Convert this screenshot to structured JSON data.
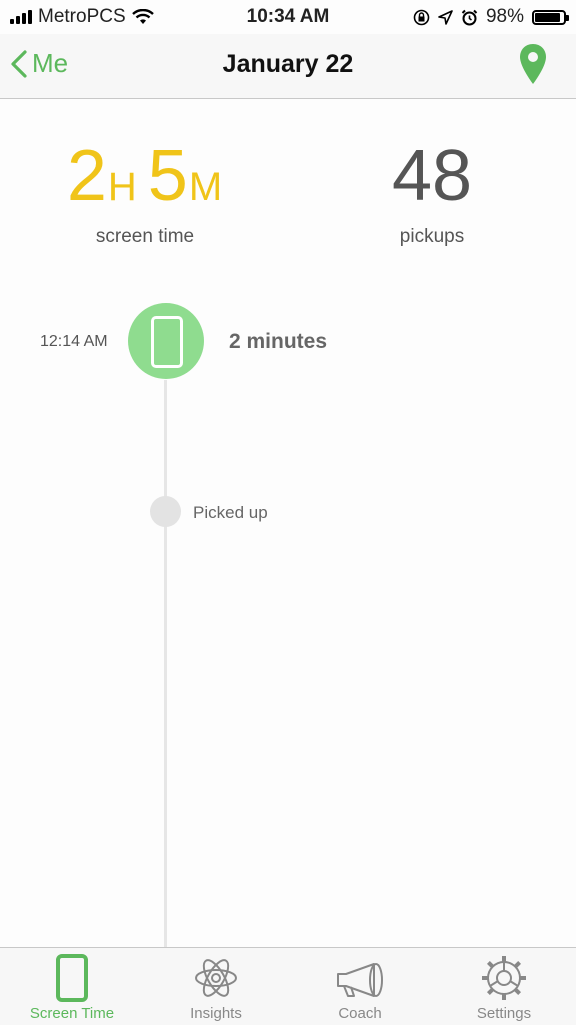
{
  "status": {
    "carrier": "MetroPCS",
    "time": "10:34 AM",
    "battery": "98%",
    "battery_level": 0.98
  },
  "nav": {
    "back_label": "Me",
    "title": "January 22",
    "location_icon": "location-pin-icon"
  },
  "stats": {
    "screen_time_hours": "2",
    "screen_time_hours_unit": "H",
    "screen_time_minutes": "5",
    "screen_time_minutes_unit": "M",
    "screen_time_label": "screen time",
    "pickups_value": "48",
    "pickups_label": "pickups"
  },
  "timeline": {
    "session_time": "12:14 AM",
    "session_duration": "2 minutes",
    "event_label": "Picked up"
  },
  "tabs": [
    {
      "label": "Screen Time",
      "icon": "phone-icon",
      "active": true
    },
    {
      "label": "Insights",
      "icon": "atom-icon",
      "active": false
    },
    {
      "label": "Coach",
      "icon": "megaphone-icon",
      "active": false
    },
    {
      "label": "Settings",
      "icon": "gear-icon",
      "active": false
    }
  ],
  "colors": {
    "accent_green": "#5cb85c",
    "screen_time_yellow": "#f0c419",
    "session_green": "#8fdc8f"
  }
}
